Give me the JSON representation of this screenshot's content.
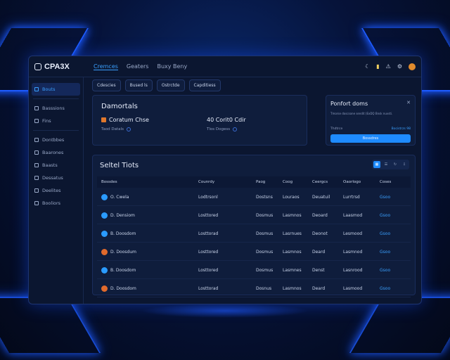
{
  "app": {
    "title": "CPA3X"
  },
  "top_tabs": [
    {
      "label": "Cremces",
      "active": true
    },
    {
      "label": "Geaters",
      "active": false
    },
    {
      "label": "Buxy Beny",
      "active": false
    }
  ],
  "top_icons": [
    "phone-icon",
    "bell-icon",
    "alert-icon",
    "settings-icon",
    "avatar"
  ],
  "sidebar": {
    "items": [
      {
        "label": "Bouts",
        "active": true
      },
      {
        "label": "Basssions"
      },
      {
        "label": "Fins"
      },
      {
        "label": "Dontbbes"
      },
      {
        "label": "Baarones"
      },
      {
        "label": "Baasts"
      },
      {
        "label": "Dessatus"
      },
      {
        "label": "Deelites"
      },
      {
        "label": "Booliors"
      }
    ]
  },
  "filters": [
    "Cdescies",
    "Bused ls",
    "Ostrctde",
    "Capditiess"
  ],
  "stats": {
    "title": "Damortals",
    "stat1": {
      "label": "Coratum Chse",
      "sub": "Taod Datals"
    },
    "stat2": {
      "label": "40 Corit0 Cdir",
      "sub": "Tlos Dogess"
    }
  },
  "promo": {
    "title": "Ponfort doms",
    "body": "Tmorse doscsone sendit (ExDQ Bnsk nuvsti.",
    "row_label": "Thdtrce",
    "row_value": "Bocistrzs 98",
    "button": "Bossdres"
  },
  "table": {
    "title": "Seltel Tiots",
    "headers": [
      "Bossdes",
      "Counrdy",
      "Paog",
      "Coog",
      "Ceergcs",
      "Oaorlogo",
      "Coses"
    ],
    "rows": [
      {
        "name": "O. Cwela",
        "country": "Lodtrsonl",
        "c3": "Dostsns",
        "c4": "Louraos",
        "c5": "Deuatuil",
        "c6": "Lurrtrsd",
        "action": "Gsoo",
        "icon_color": "#2a9bff"
      },
      {
        "name": "D. Densiom",
        "country": "Losttored",
        "c3": "Dosmus",
        "c4": "Lasmnos",
        "c5": "Deoard",
        "c6": "Laasmod",
        "action": "Gsoo",
        "icon_color": "#2a9bff"
      },
      {
        "name": "B. Doosdom",
        "country": "Losttorad",
        "c3": "Dosmus",
        "c4": "Lasrnues",
        "c5": "Deonot",
        "c6": "Lesmood",
        "action": "Gsoo",
        "icon_color": "#2a9bff"
      },
      {
        "name": "D. Doosdum",
        "country": "Losttored",
        "c3": "Dosmus",
        "c4": "Lasmnos",
        "c5": "Deard",
        "c6": "Lasmnod",
        "action": "Gsoo",
        "icon_color": "#e06a2c"
      },
      {
        "name": "B. Doosdom",
        "country": "Losttored",
        "c3": "Dosmus",
        "c4": "Lasmnes",
        "c5": "Denst",
        "c6": "Lasnrood",
        "action": "Gsoo",
        "icon_color": "#2a9bff"
      },
      {
        "name": "D. Doosdom",
        "country": "Losttorad",
        "c3": "Dosnus",
        "c4": "Lasmnos",
        "c5": "Deard",
        "c6": "Lasmood",
        "action": "Gsoo",
        "icon_color": "#e06a2c"
      }
    ]
  },
  "colors": {
    "accent": "#1e8bff",
    "panel": "#0f1d3c",
    "window": "#0b1630",
    "neon": "#1e5cff"
  }
}
